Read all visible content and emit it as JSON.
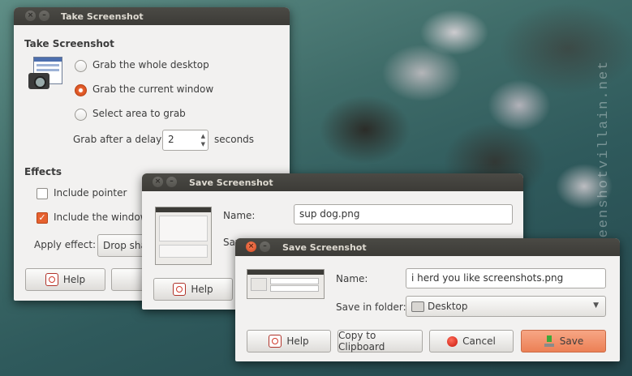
{
  "watermark": "screenshotvillain.net",
  "take_window": {
    "title": "Take Screenshot",
    "heading": "Take Screenshot",
    "options": [
      {
        "label": "Grab the whole desktop",
        "selected": false
      },
      {
        "label": "Grab the current window",
        "selected": true
      },
      {
        "label": "Select area to grab",
        "selected": false
      }
    ],
    "delay_prefix": "Grab after a delay of",
    "delay_value": "2",
    "delay_suffix": "seconds",
    "effects_heading": "Effects",
    "include_pointer": {
      "label": "Include pointer",
      "checked": false
    },
    "include_border": {
      "label": "Include the window bo",
      "checked": true
    },
    "apply_effect_label": "Apply effect:",
    "apply_effect_value": "Drop shad",
    "help_label": "Help"
  },
  "save_window_1": {
    "title": "Save Screenshot",
    "name_label": "Name:",
    "name_value": "sup dog.png",
    "save_label_partial": "Sav",
    "help_label": "Help"
  },
  "save_window_2": {
    "title": "Save Screenshot",
    "name_label": "Name:",
    "name_value": "i herd you like screenshots.png",
    "folder_label": "Save in folder:",
    "folder_value": "Desktop",
    "buttons": {
      "help": "Help",
      "clipboard": "Copy to Clipboard",
      "cancel": "Cancel",
      "save": "Save"
    }
  },
  "colors": {
    "accent": "#e6612f",
    "titlebar": "#3c3b37",
    "save_button": "#ec8055"
  }
}
